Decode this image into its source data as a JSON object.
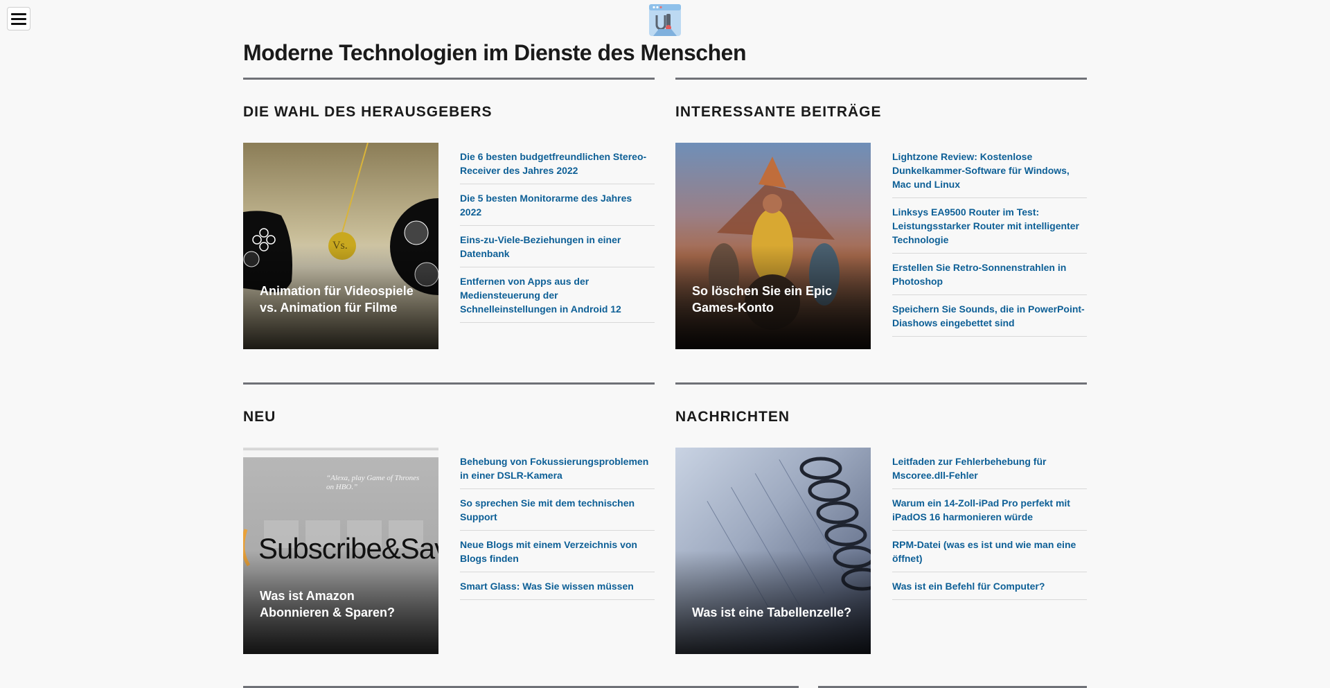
{
  "site": {
    "title": "Moderne Technologien im Dienste des Menschen"
  },
  "sections": [
    {
      "heading": "DIE WAHL DES HERAUSGEBERS",
      "feature": {
        "caption": "Animation für Videospiele vs. Animation für Filme",
        "badge": "Vs."
      },
      "links": [
        "Die 6 besten budgetfreundlichen Stereo-Receiver des Jahres 2022",
        "Die 5 besten Monitorarme des Jahres 2022",
        "Eins-zu-Viele-Beziehungen in einer Datenbank",
        "Entfernen von Apps aus der Mediensteuerung der Schnelleinstellungen in Android 12"
      ]
    },
    {
      "heading": "INTERESSANTE BEITRÄGE",
      "feature": {
        "caption": "So löschen Sie ein Epic Games-Konto"
      },
      "links": [
        "Lightzone Review: Kostenlose Dunkelkammer-Software für Windows, Mac und Linux",
        "Linksys EA9500 Router im Test: Leistungsstarker Router mit intelligenter Technologie",
        "Erstellen Sie Retro-Sonnenstrahlen in Photoshop",
        "Speichern Sie Sounds, die in PowerPoint-Diashows eingebettet sind"
      ]
    },
    {
      "heading": "NEU",
      "feature": {
        "caption": "Was ist Amazon Abonnieren & Sparen?",
        "overlay_text": "Subscribe&Save",
        "quote": "“Alexa, play Game of Thrones on HBO.”"
      },
      "links": [
        "Behebung von Fokussierungsproblemen in einer DSLR-Kamera",
        "So sprechen Sie mit dem technischen Support",
        "Neue Blogs mit einem Verzeichnis von Blogs finden",
        "Smart Glass: Was Sie wissen müssen"
      ]
    },
    {
      "heading": "NACHRICHTEN",
      "feature": {
        "caption": "Was ist eine Tabellenzelle?"
      },
      "links": [
        "Leitfaden zur Fehlerbehebung für Mscoree.dll-Fehler",
        "Warum ein 14-Zoll-iPad Pro perfekt mit iPadOS 16 harmonieren würde",
        "RPM-Datei (was es ist und wie man eine öffnet)",
        "Was ist ein Befehl für Computer?"
      ]
    }
  ],
  "colors": {
    "background": "#f8f8f8",
    "link": "#0d5f96",
    "rule": "#6f7177",
    "heading": "#1a1a1a"
  }
}
